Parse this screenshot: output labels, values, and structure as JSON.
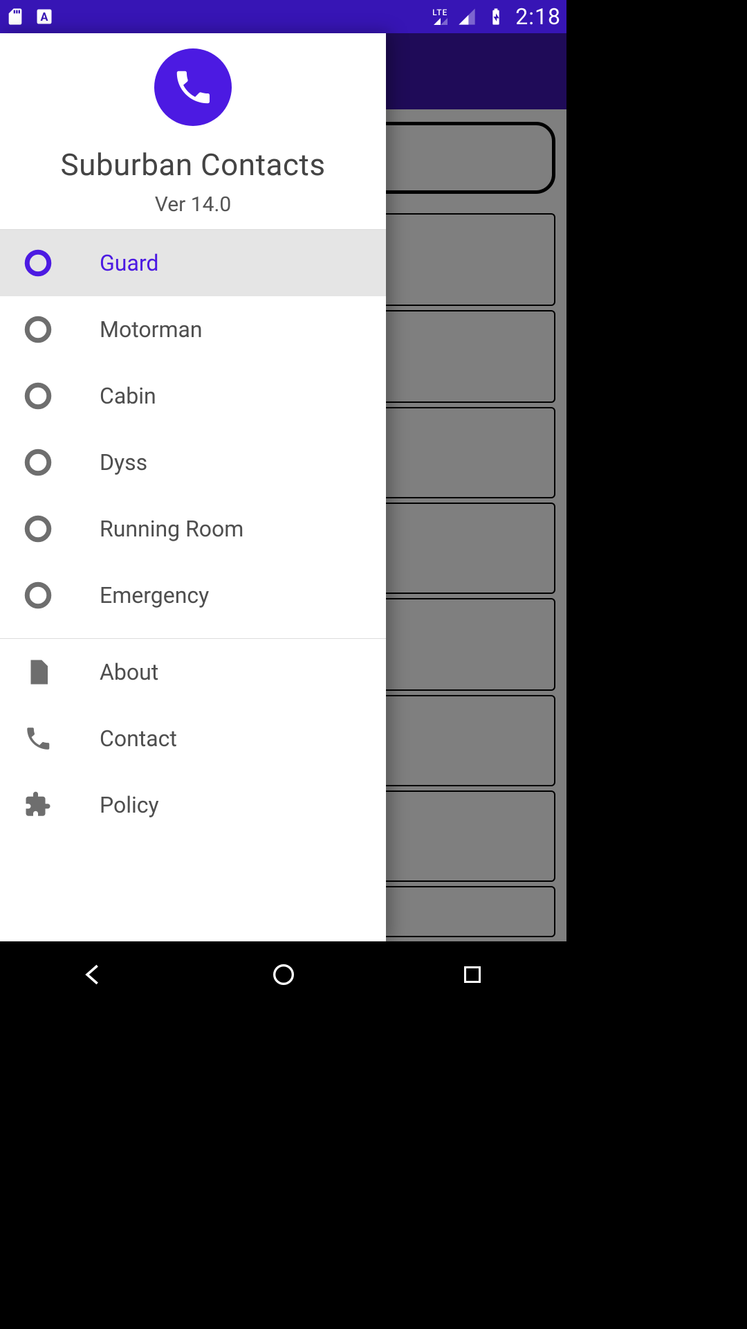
{
  "statusbar": {
    "lte": "LTE",
    "time": "2:18"
  },
  "drawer": {
    "title": "Suburban Contacts",
    "version": "Ver 14.0",
    "active_index": 0,
    "group1": [
      {
        "label": "Guard"
      },
      {
        "label": "Motorman"
      },
      {
        "label": "Cabin"
      },
      {
        "label": "Dyss"
      },
      {
        "label": "Running Room"
      },
      {
        "label": "Emergency"
      }
    ],
    "group2": [
      {
        "label": "About"
      },
      {
        "label": "Contact"
      },
      {
        "label": "Policy"
      }
    ]
  },
  "colors": {
    "primary": "#4c1ae2",
    "statusbar_bg": "#3715b5",
    "toolbar_bg": "#3e17b0"
  }
}
